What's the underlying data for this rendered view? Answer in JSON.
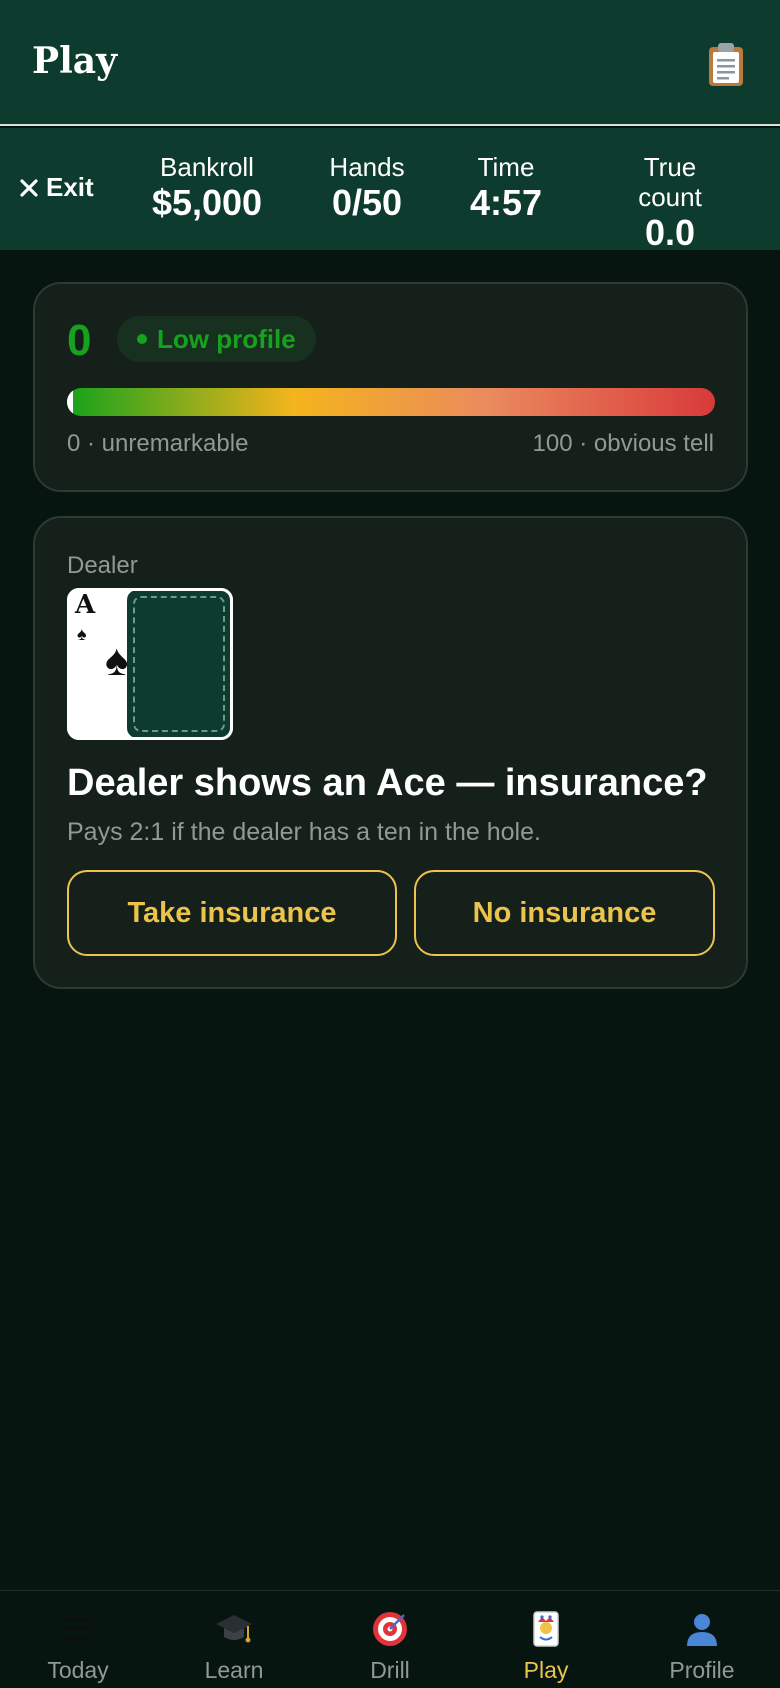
{
  "header": {
    "title": "Play",
    "notes_icon": "clipboard-icon"
  },
  "stats": {
    "exit_label": "Exit",
    "bankroll": {
      "label": "Bankroll",
      "value": "$5,000"
    },
    "hands": {
      "label": "Hands",
      "value": "0/50"
    },
    "time": {
      "label": "Time",
      "value": "4:57"
    },
    "true_count": {
      "label": "True count",
      "value": "0.0"
    }
  },
  "profile": {
    "score": "0",
    "badge": "Low profile",
    "level": 0,
    "scale_min": "0 · unremarkable",
    "scale_max": "100 · obvious tell",
    "colors": {
      "low": "#16a21c",
      "mid": "#f4b41c",
      "high": "#d83a3a"
    }
  },
  "table": {
    "dealer_label": "Dealer",
    "dealer_up_card": {
      "rank": "A",
      "suit": "♠"
    },
    "dealer_hole_card": "face-down",
    "prompt": "Dealer shows an Ace — insurance?",
    "subprompt": "Pays 2:1 if the dealer has a ten in the hole.",
    "take_label": "Take insurance",
    "decline_label": "No insurance"
  },
  "nav": {
    "items": [
      {
        "label": "Today",
        "icon": "menu-icon"
      },
      {
        "label": "Learn",
        "icon": "graduation-cap-icon"
      },
      {
        "label": "Drill",
        "icon": "target-icon"
      },
      {
        "label": "Play",
        "icon": "joker-card-icon"
      },
      {
        "label": "Profile",
        "icon": "user-icon"
      }
    ],
    "active": "Play"
  },
  "colors": {
    "accent": "#ecc34b",
    "felt": "#0d3b2e",
    "background": "#061510"
  }
}
